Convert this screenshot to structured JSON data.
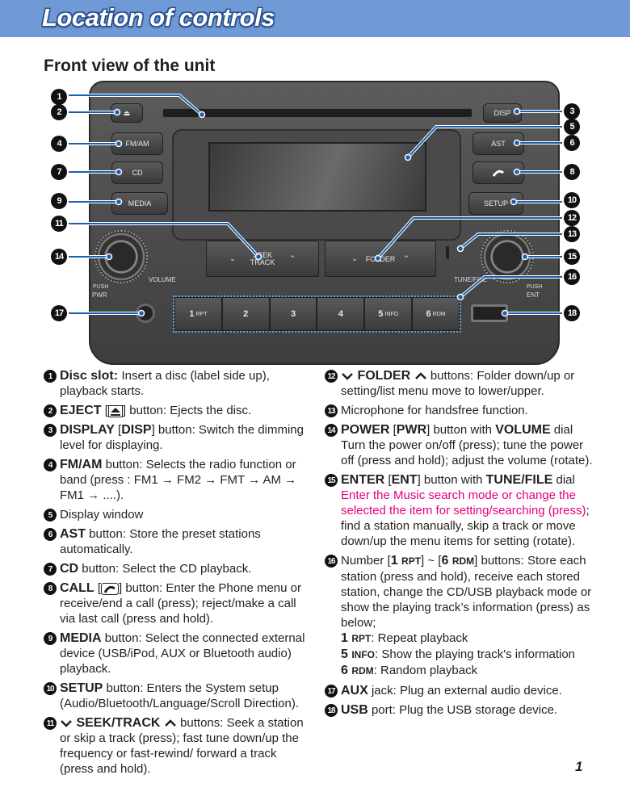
{
  "header": {
    "title": "Location of controls"
  },
  "subtitle": "Front view of the unit",
  "unit": {
    "eject": "⏏",
    "disp": "DISP",
    "fmam": "FM/AM",
    "cd": "CD",
    "media": "MEDIA",
    "ast": "AST",
    "setup": "SETUP",
    "seek_top": "SEEK",
    "seek_bottom": "TRACK",
    "folder": "FOLDER",
    "volume": "VOLUME",
    "tunefile": "TUNE/FILE",
    "push_l": "PUSH",
    "pwr": "PWR",
    "push_r": "PUSH",
    "ent": "ENT",
    "presets": [
      {
        "n": "1",
        "s": "RPT"
      },
      {
        "n": "2",
        "s": ""
      },
      {
        "n": "3",
        "s": ""
      },
      {
        "n": "4",
        "s": ""
      },
      {
        "n": "5",
        "s": "INFO"
      },
      {
        "n": "6",
        "s": "RDM"
      }
    ]
  },
  "callout_color": "#1b5fb0",
  "accent_pink": "#e6007e",
  "left_items": [
    {
      "num": "1",
      "parts": [
        {
          "t": "Disc slot: "
        },
        {
          "t": "Insert a disc (label side up), playback starts."
        }
      ]
    },
    {
      "num": "2",
      "parts": [
        {
          "t": "EJECT",
          "b": 1
        },
        {
          "t": " ["
        },
        {
          "icon": "eject"
        },
        {
          "t": "] button: Ejects the disc."
        }
      ]
    },
    {
      "num": "3",
      "parts": [
        {
          "t": "DISPLAY",
          "b": 1
        },
        {
          "t": " ["
        },
        {
          "t": "DISP",
          "b": 1
        },
        {
          "t": "] button: Switch the dimming level for displaying."
        }
      ]
    },
    {
      "num": "4",
      "parts": [
        {
          "t": "FM/AM",
          "b": 1
        },
        {
          "t": " button: Selects the radio function or band (press : FM1 → FM2 → FMT → AM → FM1 → ....)."
        }
      ]
    },
    {
      "num": "5",
      "parts": [
        {
          "t": "Display window"
        }
      ]
    },
    {
      "num": "6",
      "parts": [
        {
          "t": "AST",
          "b": 1
        },
        {
          "t": " button: Store the preset stations automatically."
        }
      ]
    },
    {
      "num": "7",
      "parts": [
        {
          "t": "CD",
          "b": 1
        },
        {
          "t": " button: Select the CD playback."
        }
      ]
    },
    {
      "num": "8",
      "parts": [
        {
          "t": "CALL",
          "b": 1
        },
        {
          "t": " ["
        },
        {
          "icon": "phone"
        },
        {
          "t": "] button: Enter the Phone menu or receive/end a call (press); reject/make a call via last call (press and hold)."
        }
      ]
    },
    {
      "num": "9",
      "parts": [
        {
          "t": "MEDIA",
          "b": 1
        },
        {
          "t": " button: Select the connected external device (USB/iPod, AUX or Bluetooth audio) playback."
        }
      ]
    },
    {
      "num": "10",
      "parts": [
        {
          "t": "SETUP",
          "b": 1
        },
        {
          "t": " button: Enters the System setup (Audio/Bluetooth/Language/Scroll Direction)."
        }
      ]
    },
    {
      "num": "11",
      "parts": [
        {
          "icon": "down"
        },
        {
          "t": " SEEK/TRACK ",
          "b": 1
        },
        {
          "icon": "up"
        },
        {
          "t": " buttons: Seek a station or skip a track (press); fast tune down/up the frequency or fast-rewind/ forward a track (press and hold)."
        }
      ]
    }
  ],
  "right_items": [
    {
      "num": "12",
      "parts": [
        {
          "t": " "
        },
        {
          "icon": "down"
        },
        {
          "t": " FOLDER ",
          "b": 1
        },
        {
          "icon": "up"
        },
        {
          "t": " buttons: Folder down/up or setting/list menu move to lower/upper."
        }
      ]
    },
    {
      "num": "13",
      "parts": [
        {
          "t": "Microphone for handsfree function."
        }
      ]
    },
    {
      "num": "14",
      "parts": [
        {
          "t": "POWER",
          "b": 1
        },
        {
          "t": " ["
        },
        {
          "t": "PWR",
          "b": 1
        },
        {
          "t": "] button with "
        },
        {
          "t": "VOLUME",
          "b": 1
        },
        {
          "t": " dial"
        },
        {
          "br": 1
        },
        {
          "t": "Turn the power on/off (press); tune the power off (press and hold); adjust the volume (rotate)."
        }
      ]
    },
    {
      "num": "15",
      "parts": [
        {
          "t": "ENTER",
          "b": 1
        },
        {
          "t": " ["
        },
        {
          "t": "ENT",
          "b": 1
        },
        {
          "t": "] button with "
        },
        {
          "t": "TUNE/FILE",
          "b": 1
        },
        {
          "t": " dial"
        },
        {
          "br": 1
        },
        {
          "t": "Enter the Music search mode or change the selected the item for setting/searching (press)",
          "pink": 1
        },
        {
          "t": "; find a station manually, skip a track or move down/up the menu items for setting (rotate)."
        }
      ]
    },
    {
      "num": "16",
      "parts": [
        {
          "t": "Number ["
        },
        {
          "t": "1 ",
          "b": 1
        },
        {
          "t": "RPT",
          "sm": 1
        },
        {
          "t": "] ~ ["
        },
        {
          "t": "6 ",
          "b": 1
        },
        {
          "t": "RDM",
          "sm": 1
        },
        {
          "t": "] buttons: Store each station (press and hold), receive each stored station, change the CD/USB playback mode or show the playing track’s information (press) as below;"
        },
        {
          "br": 1
        },
        {
          "t": "1 ",
          "b": 1
        },
        {
          "t": "RPT",
          "sm": 1
        },
        {
          "t": ": Repeat playback"
        },
        {
          "br": 1
        },
        {
          "t": "5 ",
          "b": 1
        },
        {
          "t": "INFO",
          "sm": 1
        },
        {
          "t": ": Show the playing track's information"
        },
        {
          "br": 1
        },
        {
          "t": "6 ",
          "b": 1
        },
        {
          "t": "RDM",
          "sm": 1
        },
        {
          "t": ": Random playback"
        }
      ]
    },
    {
      "num": "17",
      "parts": [
        {
          "t": "AUX",
          "b": 1
        },
        {
          "t": " jack: Plug an external audio device."
        }
      ]
    },
    {
      "num": "18",
      "parts": [
        {
          "t": "USB",
          "b": 1
        },
        {
          "t": " port: Plug the USB storage device."
        }
      ]
    }
  ],
  "page_number": "1"
}
